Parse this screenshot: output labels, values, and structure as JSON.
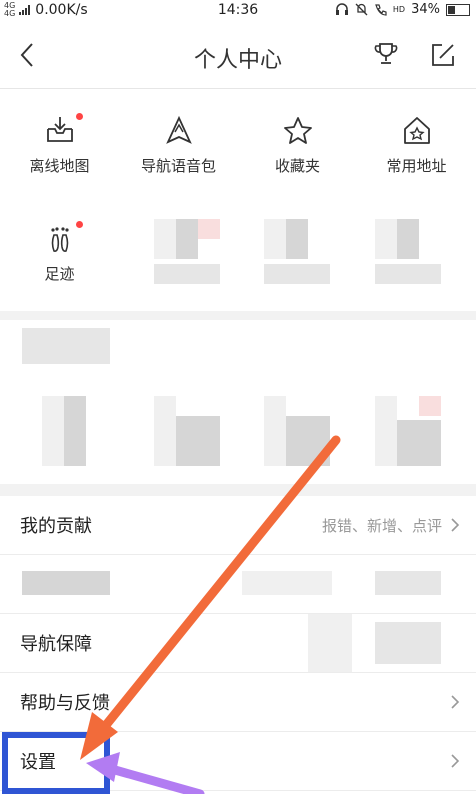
{
  "status": {
    "network": "4G\n4G",
    "speed": "0.00K/s",
    "time": "14:36",
    "hd": "HD",
    "battery": "34%"
  },
  "header": {
    "title": "个人中心"
  },
  "shortcuts": [
    {
      "label": "离线地图",
      "icon": "download-tray-icon",
      "badge": true
    },
    {
      "label": "导航语音包",
      "icon": "navigation-voice-icon",
      "badge": false
    },
    {
      "label": "收藏夹",
      "icon": "star-icon",
      "badge": false
    },
    {
      "label": "常用地址",
      "icon": "home-star-icon",
      "badge": false
    },
    {
      "label": "足迹",
      "icon": "footprint-icon",
      "badge": true
    }
  ],
  "menu": [
    {
      "label": "我的贡献",
      "sub": "报错、新增、点评"
    },
    {
      "label": "导航保障",
      "sub": ""
    },
    {
      "label": "帮助与反馈",
      "sub": ""
    },
    {
      "label": "设置",
      "sub": ""
    }
  ],
  "colors": {
    "badge": "#ff4444",
    "highlight_box": "#2f55d4",
    "arrow_orange": "#f26b3a",
    "arrow_purple": "#b27cf2"
  }
}
